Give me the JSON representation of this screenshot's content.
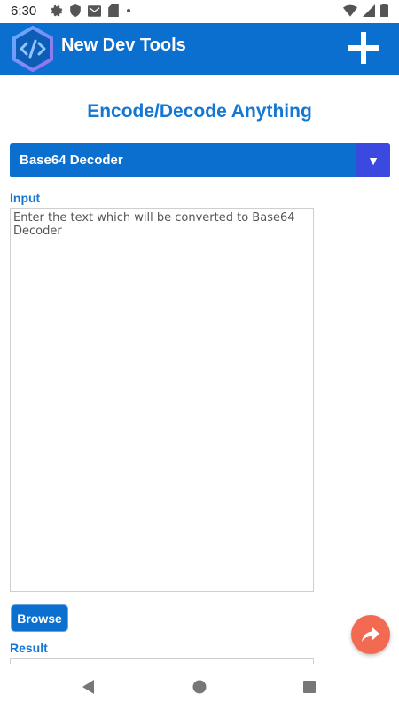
{
  "status_bar": {
    "time": "6:30",
    "icons": [
      "settings-icon",
      "shield-icon",
      "mail-icon",
      "sd-card-icon",
      "dot-icon",
      "wifi-icon",
      "signal-icon",
      "battery-icon"
    ]
  },
  "app_bar": {
    "title": "New Dev Tools",
    "logo_icon": "code-hexagon-icon",
    "add_icon": "plus-icon"
  },
  "main": {
    "heading": "Encode/Decode Anything",
    "selector": {
      "value": "Base64 Decoder",
      "arrow_icon": "triangle-down-icon"
    },
    "input_label": "Input",
    "input_placeholder": "Enter the text which will be converted to Base64 Decoder",
    "browse_label": "Browse",
    "result_label": "Result",
    "fab_icon": "share-arrow-icon"
  },
  "nav_bar": {
    "icons": [
      "back-icon",
      "home-icon",
      "recents-icon"
    ]
  },
  "colors": {
    "primary": "#0b6fd0",
    "heading": "#1677d2",
    "dropdown_accent": "#3b49e0",
    "fab": "#f36a52"
  }
}
